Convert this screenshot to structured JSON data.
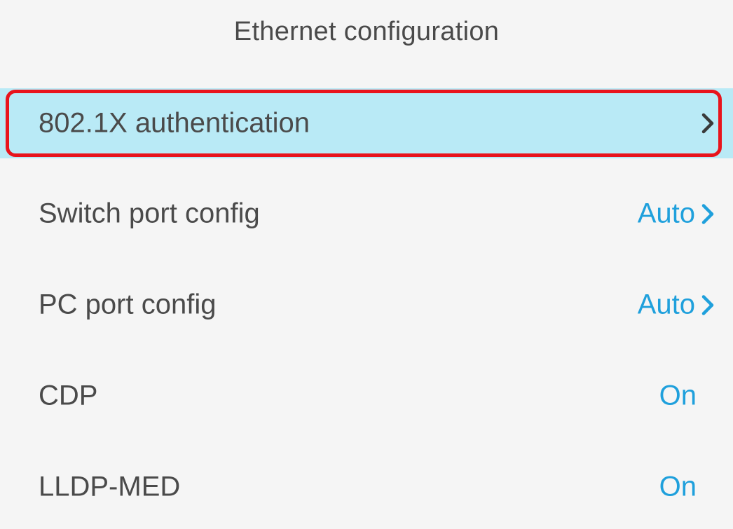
{
  "screen": {
    "title": "Ethernet configuration"
  },
  "colors": {
    "accent": "#1fa0dc",
    "selected_bg": "#b9eaf6",
    "highlight_border": "#e8141c",
    "text": "#4a4a4a"
  },
  "items": [
    {
      "label": "802.1X authentication",
      "value": "",
      "chevron": true,
      "selected": true
    },
    {
      "label": "Switch port config",
      "value": "Auto",
      "chevron": true,
      "selected": false
    },
    {
      "label": "PC port config",
      "value": "Auto",
      "chevron": true,
      "selected": false
    },
    {
      "label": "CDP",
      "value": "On",
      "chevron": false,
      "selected": false
    },
    {
      "label": "LLDP-MED",
      "value": "On",
      "chevron": false,
      "selected": false
    }
  ]
}
